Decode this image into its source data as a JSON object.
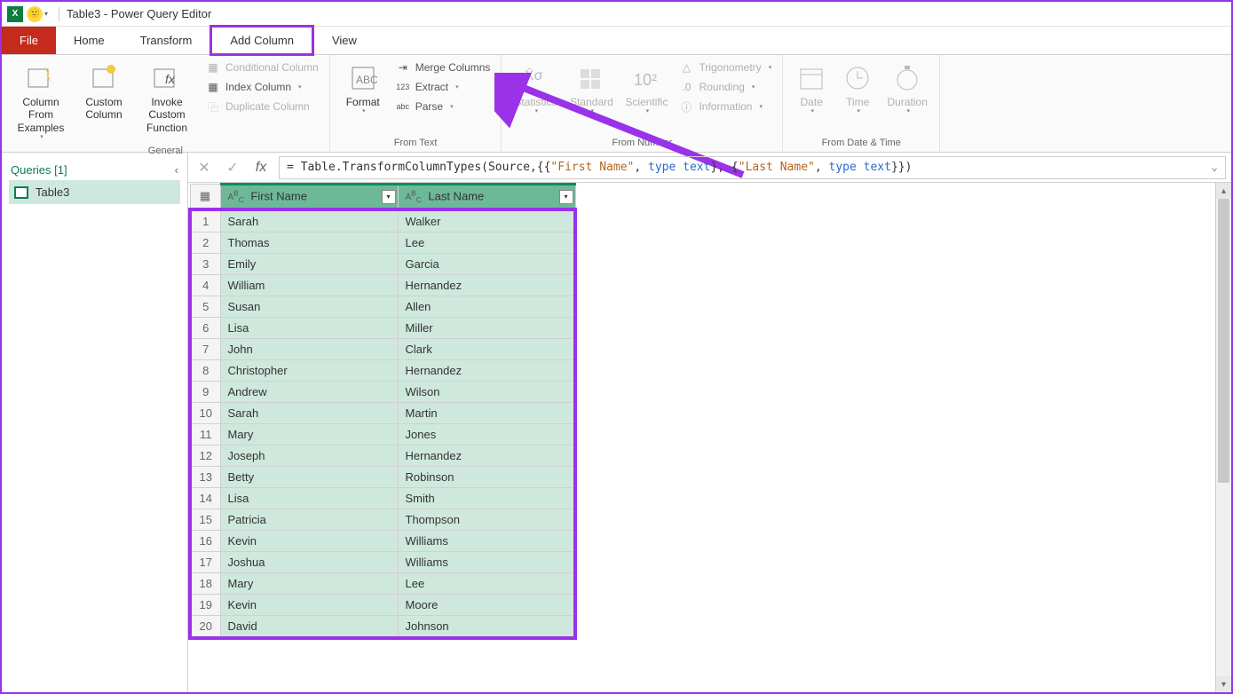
{
  "title": "Table3 - Power Query Editor",
  "tabs": {
    "file": "File",
    "home": "Home",
    "transform": "Transform",
    "add_column": "Add Column",
    "view": "View"
  },
  "ribbon": {
    "general": {
      "label": "General",
      "col_from_examples": "Column From Examples",
      "custom_column": "Custom Column",
      "invoke_custom_fn": "Invoke Custom Function",
      "conditional": "Conditional Column",
      "index": "Index Column",
      "duplicate": "Duplicate Column"
    },
    "from_text": {
      "label": "From Text",
      "format": "Format",
      "merge": "Merge Columns",
      "extract": "Extract",
      "parse": "Parse"
    },
    "from_number": {
      "label": "From Number",
      "statistics": "Statistics",
      "standard": "Standard",
      "scientific": "Scientific",
      "trig": "Trigonometry",
      "rounding": "Rounding",
      "information": "Information"
    },
    "from_datetime": {
      "label": "From Date & Time",
      "date": "Date",
      "time": "Time",
      "duration": "Duration"
    }
  },
  "queries": {
    "header": "Queries [1]",
    "item": "Table3"
  },
  "fx": {
    "prefix": "= Table.TransformColumnTypes(Source,{{",
    "s1": "\"First Name\"",
    "mid1": ", ",
    "kw1": "type",
    "mid1b": " ",
    "kw2": "text",
    "mid2": "}, {",
    "s2": "\"Last Name\"",
    "mid3": ", ",
    "kw3": "type",
    "mid3b": " ",
    "kw4": "text",
    "suffix": "}})"
  },
  "columns": {
    "c1": "First Name",
    "c2": "Last Name"
  },
  "rows": [
    {
      "n": "1",
      "a": "Sarah",
      "b": "Walker"
    },
    {
      "n": "2",
      "a": "Thomas",
      "b": "Lee"
    },
    {
      "n": "3",
      "a": "Emily",
      "b": "Garcia"
    },
    {
      "n": "4",
      "a": "William",
      "b": "Hernandez"
    },
    {
      "n": "5",
      "a": "Susan",
      "b": "Allen"
    },
    {
      "n": "6",
      "a": "Lisa",
      "b": "Miller"
    },
    {
      "n": "7",
      "a": "John",
      "b": "Clark"
    },
    {
      "n": "8",
      "a": "Christopher",
      "b": "Hernandez"
    },
    {
      "n": "9",
      "a": "Andrew",
      "b": "Wilson"
    },
    {
      "n": "10",
      "a": "Sarah",
      "b": "Martin"
    },
    {
      "n": "11",
      "a": "Mary",
      "b": "Jones"
    },
    {
      "n": "12",
      "a": "Joseph",
      "b": "Hernandez"
    },
    {
      "n": "13",
      "a": "Betty",
      "b": "Robinson"
    },
    {
      "n": "14",
      "a": "Lisa",
      "b": "Smith"
    },
    {
      "n": "15",
      "a": "Patricia",
      "b": "Thompson"
    },
    {
      "n": "16",
      "a": "Kevin",
      "b": "Williams"
    },
    {
      "n": "17",
      "a": "Joshua",
      "b": "Williams"
    },
    {
      "n": "18",
      "a": "Mary",
      "b": "Lee"
    },
    {
      "n": "19",
      "a": "Kevin",
      "b": "Moore"
    },
    {
      "n": "20",
      "a": "David",
      "b": "Johnson"
    }
  ]
}
